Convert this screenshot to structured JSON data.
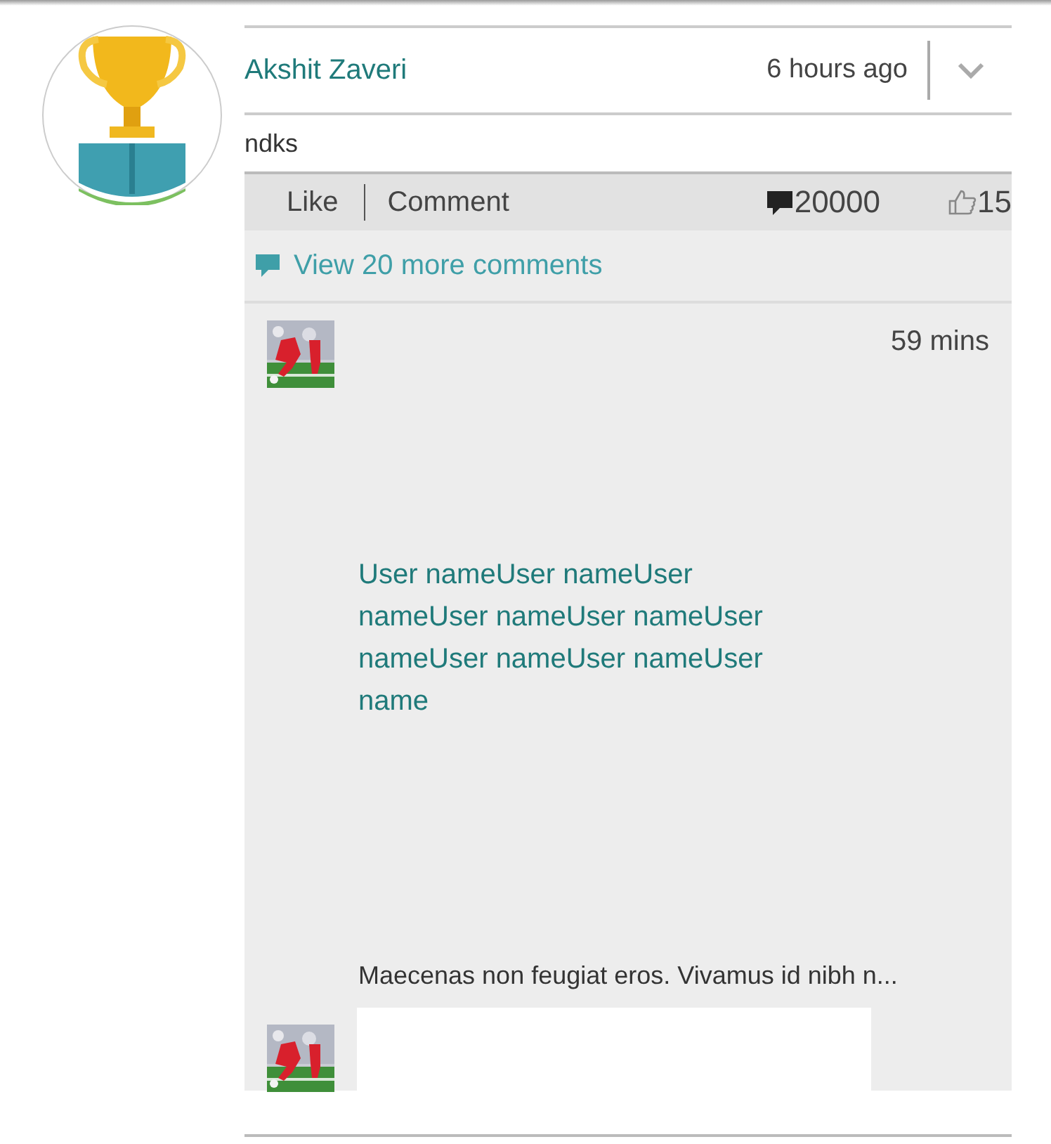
{
  "post": {
    "author": "Akshit Zaveri",
    "time": "6 hours ago",
    "text": "ndks",
    "actions": [
      "Like",
      "Comment"
    ],
    "comment_count": "20000",
    "like_count": "15",
    "view_more": "View 20 more comments",
    "comments": [
      {
        "time": "59 mins",
        "username": "User nameUser nameUser nameUser nameUser nameUser nameUser nameUser nameUser name",
        "text": "Maecenas non feugiat eros. Vivamus id nibh n..."
      }
    ]
  }
}
